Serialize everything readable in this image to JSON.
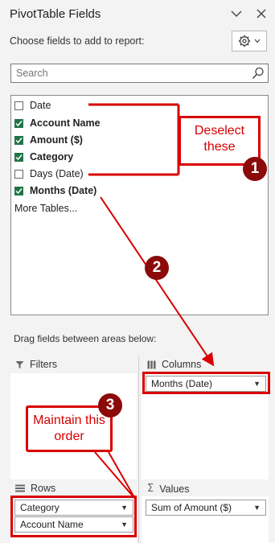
{
  "panel": {
    "title": "PivotTable Fields",
    "subtitle": "Choose fields to add to report:"
  },
  "search": {
    "placeholder": "Search"
  },
  "fields": [
    {
      "label": "Date",
      "checked": false,
      "bold": false
    },
    {
      "label": "Account Name",
      "checked": true,
      "bold": true
    },
    {
      "label": "Amount ($)",
      "checked": true,
      "bold": true
    },
    {
      "label": "Category",
      "checked": true,
      "bold": true
    },
    {
      "label": "Days (Date)",
      "checked": false,
      "bold": false
    },
    {
      "label": "Months (Date)",
      "checked": true,
      "bold": true
    }
  ],
  "more_tables": "More Tables...",
  "drag_hint": "Drag fields between areas below:",
  "areas": {
    "filters": {
      "label": "Filters",
      "items": []
    },
    "columns": {
      "label": "Columns",
      "items": [
        "Months (Date)"
      ]
    },
    "rows": {
      "label": "Rows",
      "items": [
        "Category",
        "Account Name"
      ]
    },
    "values": {
      "label": "Values",
      "items": [
        "Sum of Amount ($)"
      ]
    }
  },
  "annotations": {
    "deselect": "Deselect these",
    "maintain": "Maintain this order",
    "badge1": "1",
    "badge2": "2",
    "badge3": "3",
    "color": "#d90000",
    "badge_color": "#8b0a0a"
  },
  "icons": {
    "collapse": "chevron-down-icon",
    "close": "close-icon",
    "gear": "gear-icon",
    "search": "search-icon",
    "filter": "filter-icon",
    "columns": "columns-icon",
    "rows": "rows-icon",
    "values": "sigma-icon"
  }
}
